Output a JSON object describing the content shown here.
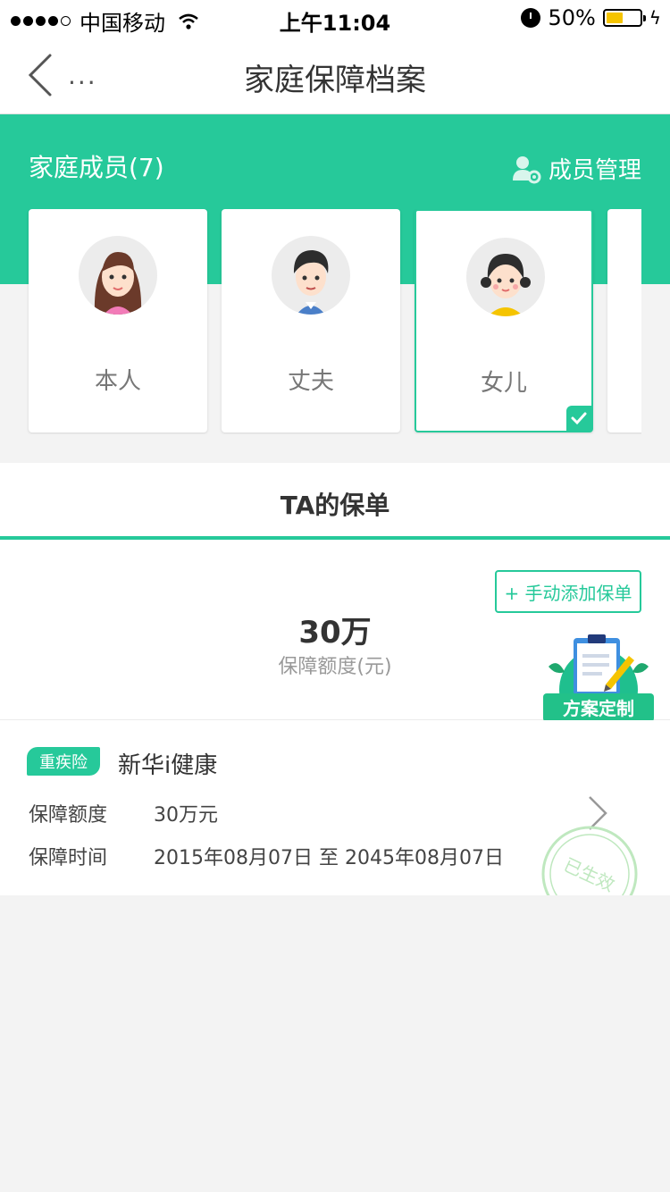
{
  "status_bar": {
    "carrier": "中国移动",
    "time": "上午11:04",
    "battery": "50%",
    "battery_level": 0.5
  },
  "nav": {
    "more": "...",
    "title": "家庭保障档案"
  },
  "members": {
    "title": "家庭成员(7)",
    "manage_label": "成员管理",
    "cards": [
      {
        "label": "本人",
        "avatar": "woman-avatar",
        "selected": false
      },
      {
        "label": "丈夫",
        "avatar": "man-avatar",
        "selected": false
      },
      {
        "label": "女儿",
        "avatar": "girl-avatar",
        "selected": true
      }
    ]
  },
  "policy": {
    "tab_label": "TA的保单",
    "add_button": "+ 手动添加保单",
    "total_amount": "30万",
    "total_label": "保障额度(元)",
    "plan_badge": "方案定制",
    "items": [
      {
        "tag": "重疾险",
        "name": "新华i健康",
        "coverage_label": "保障额度",
        "coverage_value": "30万元",
        "period_label": "保障时间",
        "period_value": "2015年08月07日 至 2045年08月07日",
        "status": "已生效"
      }
    ]
  },
  "colors": {
    "accent": "#26c99a",
    "background": "#f3f3f3"
  }
}
